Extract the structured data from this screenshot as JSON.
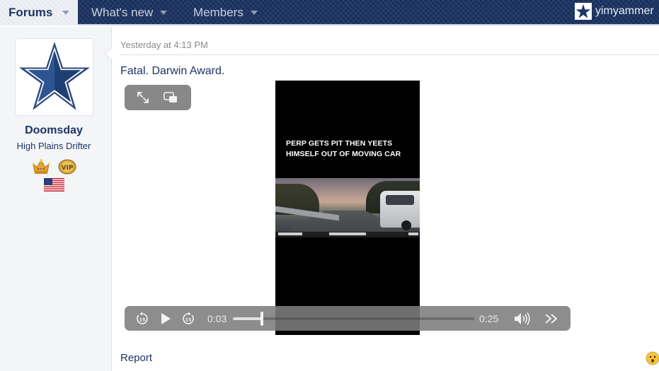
{
  "nav": {
    "forums": "Forums",
    "whats_new": "What's new",
    "members": "Members",
    "username": "yimyammer"
  },
  "user": {
    "name": "Doomsday",
    "title": "High Plains Drifter",
    "badges": [
      "crown-icon",
      "vip-badge-icon",
      "us-flag-icon"
    ]
  },
  "post": {
    "date": "Yesterday at 4:13 PM",
    "text": "Fatal. Darwin Award.",
    "report_label": "Report"
  },
  "video": {
    "caption": "PERP GETS PIT THEN YEETS HIMSELF OUT OF MOVING CAR",
    "current_time": "0:03",
    "total_time": "0:25",
    "progress": 0.12
  },
  "colors": {
    "brand_navy": "#1d3566",
    "nav_bg": "#1d3566",
    "sidebar_bg": "#f4f5f7"
  }
}
